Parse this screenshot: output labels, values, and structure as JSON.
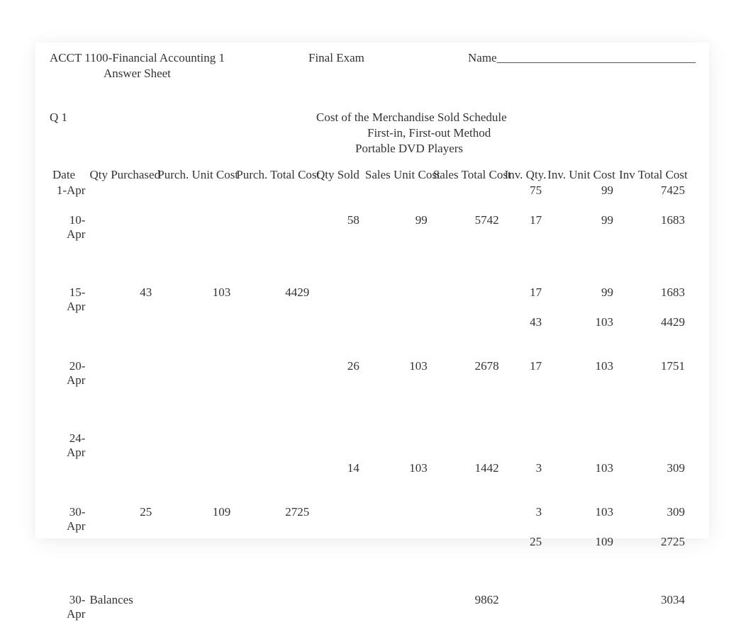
{
  "header": {
    "course": "ACCT 1100-Financial Accounting 1",
    "exam": "Final Exam",
    "name_label": "Name_________________________________",
    "answer_sheet": "Answer Sheet"
  },
  "question": {
    "label": "Q 1",
    "title1": "Cost of the Merchandise Sold Schedule",
    "title2": "First-in, First-out Method",
    "title3": "Portable DVD Players"
  },
  "columns": {
    "date": "Date",
    "qty_purchased": "Qty Purchased",
    "purch_unit_cost": "Purch. Unit Cost",
    "purch_total_cost": "Purch. Total Cost",
    "qty_sold": "Qty Sold",
    "sales_unit_cost": "Sales Unit Cost",
    "sales_total_cost": "Sales Total Cost",
    "inv_qty": "Inv. Qty.",
    "inv_unit_cost": "Inv. Unit Cost",
    "inv_total_cost": "Inv Total Cost"
  },
  "rows": {
    "r1_date": "1-Apr",
    "r1_iq": "75",
    "r1_iuc": "99",
    "r1_itc": "7425",
    "r2_date": "10-Apr",
    "r2_qs": "58",
    "r2_suc": "99",
    "r2_stc": "5742",
    "r2_iq": "17",
    "r2_iuc": "99",
    "r2_itc": "1683",
    "r3_date": "15-Apr",
    "r3_qp": "43",
    "r3_puc": "103",
    "r3_ptc": "4429",
    "r3_iq": "17",
    "r3_iuc": "99",
    "r3_itc": "1683",
    "r3b_iq": "43",
    "r3b_iuc": "103",
    "r3b_itc": "4429",
    "r4_date": "20-Apr",
    "r4_qs": "26",
    "r4_suc": "103",
    "r4_stc": "2678",
    "r4_iq": "17",
    "r4_iuc": "103",
    "r4_itc": "1751",
    "r5_date": "24-Apr",
    "r5_qs": "14",
    "r5_suc": "103",
    "r5_stc": "1442",
    "r5_iq": "3",
    "r5_iuc": "103",
    "r5_itc": "309",
    "r6_date": "30-Apr",
    "r6_qp": "25",
    "r6_puc": "109",
    "r6_ptc": "2725",
    "r6_iq": "3",
    "r6_iuc": "103",
    "r6_itc": "309",
    "r6b_iq": "25",
    "r6b_iuc": "109",
    "r6b_itc": "2725",
    "r7_date": "30-Apr",
    "r7_label": "Balances",
    "r7_stc": "9862",
    "r7_itc": "3034"
  }
}
